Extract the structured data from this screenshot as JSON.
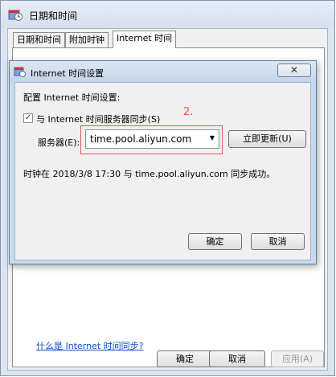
{
  "outer_window": {
    "title": "日期和时间",
    "tabs": [
      "日期和时间",
      "附加时钟",
      "Internet 时间"
    ],
    "help_link": "什么是 Internet 时间同步?",
    "ok_label": "确定",
    "cancel_label": "取消",
    "apply_label": "应用(A)"
  },
  "dialog": {
    "title": "Internet 时间设置",
    "close_glyph": "✕",
    "config_label": "配置 Internet 时间设置:",
    "sync_checked": true,
    "sync_label": "与 Internet 时间服务器同步(S)",
    "server_label": "服务器(E):",
    "server_value": "time.pool.aliyun.com",
    "update_button": "立即更新(U)",
    "status": "时钟在 2018/3/8 17:30 与 time.pool.aliyun.com 同步成功。",
    "ok_label": "确定",
    "cancel_label": "取消"
  },
  "annotation": "2.",
  "icons": {
    "outer_icon": "date-time-icon",
    "dialog_icon": "date-time-icon",
    "dropdown": "chevron-down-icon"
  },
  "colors": {
    "annotation": "#e8524b",
    "link": "#0b4fd1"
  }
}
